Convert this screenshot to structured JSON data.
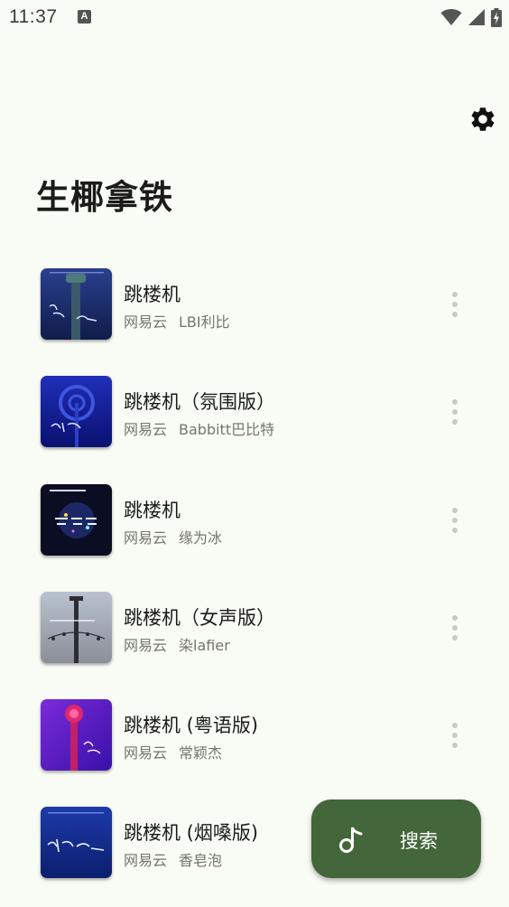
{
  "status_bar": {
    "time": "11:37",
    "notification_icon": "a-icon",
    "icons": [
      "wifi-icon",
      "signal-icon",
      "battery-charging-icon"
    ]
  },
  "app": {
    "title": "生椰拿铁",
    "settings_icon": "gear-icon"
  },
  "songs": [
    {
      "title": "跳楼机",
      "source": "网易云",
      "artist": "LBI利比"
    },
    {
      "title": "跳楼机（氛围版）",
      "source": "网易云",
      "artist": "Babbitt巴比特"
    },
    {
      "title": "跳楼机",
      "source": "网易云",
      "artist": "缘为冰"
    },
    {
      "title": "跳楼机（女声版）",
      "source": "网易云",
      "artist": "染lafier"
    },
    {
      "title": "跳楼机 (粤语版)",
      "source": "网易云",
      "artist": "常颖杰"
    },
    {
      "title": "跳楼机 (烟嗓版)",
      "source": "网易云",
      "artist": "香皂泡"
    }
  ],
  "fab": {
    "label": "搜索",
    "icon": "music-note-icon"
  },
  "colors": {
    "background": "#f9fbf5",
    "fab": "#43663a",
    "secondary_text": "#74766d"
  }
}
